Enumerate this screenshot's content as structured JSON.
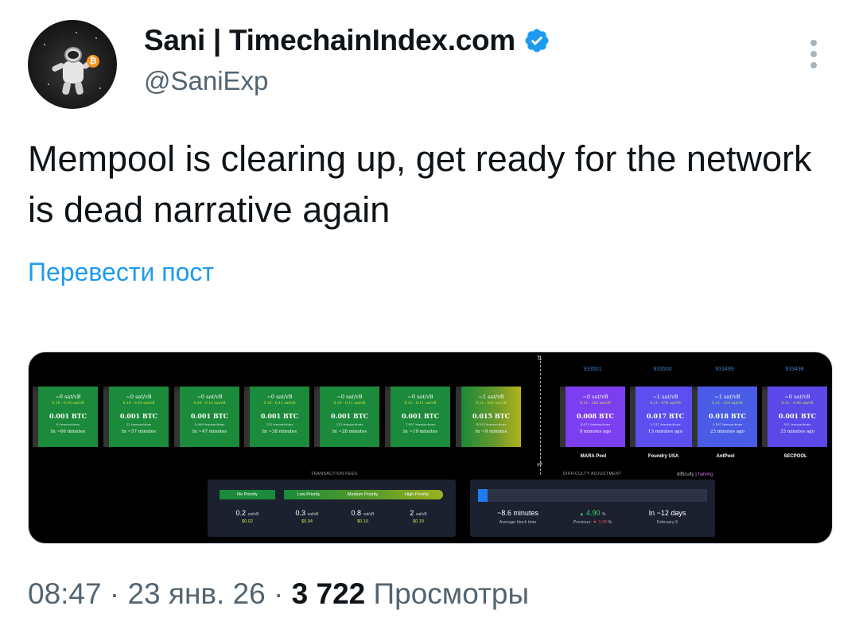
{
  "author": {
    "name": "Sani | TimechainIndex.com",
    "handle": "@SaniExp",
    "verified_color": "#1d9bf0"
  },
  "tweet": {
    "text": "Mempool is clearing up, get ready for the network is dead narrative again",
    "translate_label": "Перевести пост"
  },
  "meta": {
    "time": "08:47",
    "date": "23 янв. 26",
    "views_count": "3 722",
    "views_label": "Просмотры"
  },
  "media": {
    "pending_blocks": [
      {
        "fee": "~0 sat/vB",
        "range": "0.10 - 0.10 sat/vB",
        "size": "0.001 BTC",
        "txs": "8 transactions",
        "eta": "In ~66 minutes"
      },
      {
        "fee": "~0 sat/vB",
        "range": "0.10 - 0.10 sat/vB",
        "size": "0.001 BTC",
        "txs": "12 transactions",
        "eta": "In ~57 minutes"
      },
      {
        "fee": "~0 sat/vB",
        "range": "0.00 - 0.10 sat/vB",
        "size": "0.001 BTC",
        "txs": "3,968 transactions",
        "eta": "In ~47 minutes"
      },
      {
        "fee": "~0 sat/vB",
        "range": "0.10 - 0.11 sat/vB",
        "size": "0.001 BTC",
        "txs": "213 transactions",
        "eta": "In ~38 minutes"
      },
      {
        "fee": "~0 sat/vB",
        "range": "0.10 - 0.11 sat/vB",
        "size": "0.001 BTC",
        "txs": "213 transactions",
        "eta": "In ~28 minutes"
      },
      {
        "fee": "~0 sat/vB",
        "range": "0.11 - 0.11 sat/vB",
        "size": "0.001 BTC",
        "txs": "7,401 transactions",
        "eta": "In ~19 minutes"
      },
      {
        "fee": "~1 sat/vB",
        "range": "0.11 - 642 sat/vB",
        "size": "0.015 BTC",
        "txs": "4,923 transactions",
        "eta": "In ~9 minutes"
      }
    ],
    "mined_blocks": [
      {
        "height": "933501",
        "fee": "~0 sat/vB",
        "range": "0.11 - 162 sat/vB",
        "size": "0.008 BTC",
        "txs": "4,872 transactions",
        "ago": "9 minutes ago",
        "pool": "MARA Pool"
      },
      {
        "height": "933500",
        "fee": "~1 sat/vB",
        "range": "0.11 - 476 sat/vB",
        "size": "0.017 BTC",
        "txs": "2,311 transactions",
        "ago": "13 minutes ago",
        "pool": "Foundry USA"
      },
      {
        "height": "933499",
        "fee": "~1 sat/vB",
        "range": "0.11 - 214 sat/vB",
        "size": "0.018 BTC",
        "txs": "2,187 transactions",
        "ago": "23 minutes ago",
        "pool": "AntPool"
      },
      {
        "height": "933498",
        "fee": "~0 sat/vB",
        "range": "0.11 - 4.96 sat/vB",
        "size": "0.001 BTC",
        "txs": "521 transactions",
        "ago": "33 minutes ago",
        "pool": "SECPOOL"
      }
    ],
    "fees_title": "TRANSACTION FEES",
    "fees": {
      "labels": [
        "No Priority",
        "Low Priority",
        "Medium Priority",
        "High Priority"
      ],
      "values": [
        "0.2",
        "0.3",
        "0.8",
        "2"
      ],
      "unit": "sat/vB",
      "usd": [
        "$0.02",
        "$0.04",
        "$0.10",
        "$0.19"
      ]
    },
    "difficulty_title": "DIFFICULTY ADJUSTMENT",
    "difficulty_link": "difficulty",
    "halving_link": "halving",
    "difficulty": {
      "block_time": "~8.6 minutes",
      "block_time_label": "Average block time",
      "change": "4.90",
      "change_unit": "%",
      "previous_label": "Previous:",
      "previous": "3.28",
      "remaining": "In ~12 days",
      "date": "February 5",
      "progress": 0.04
    }
  }
}
